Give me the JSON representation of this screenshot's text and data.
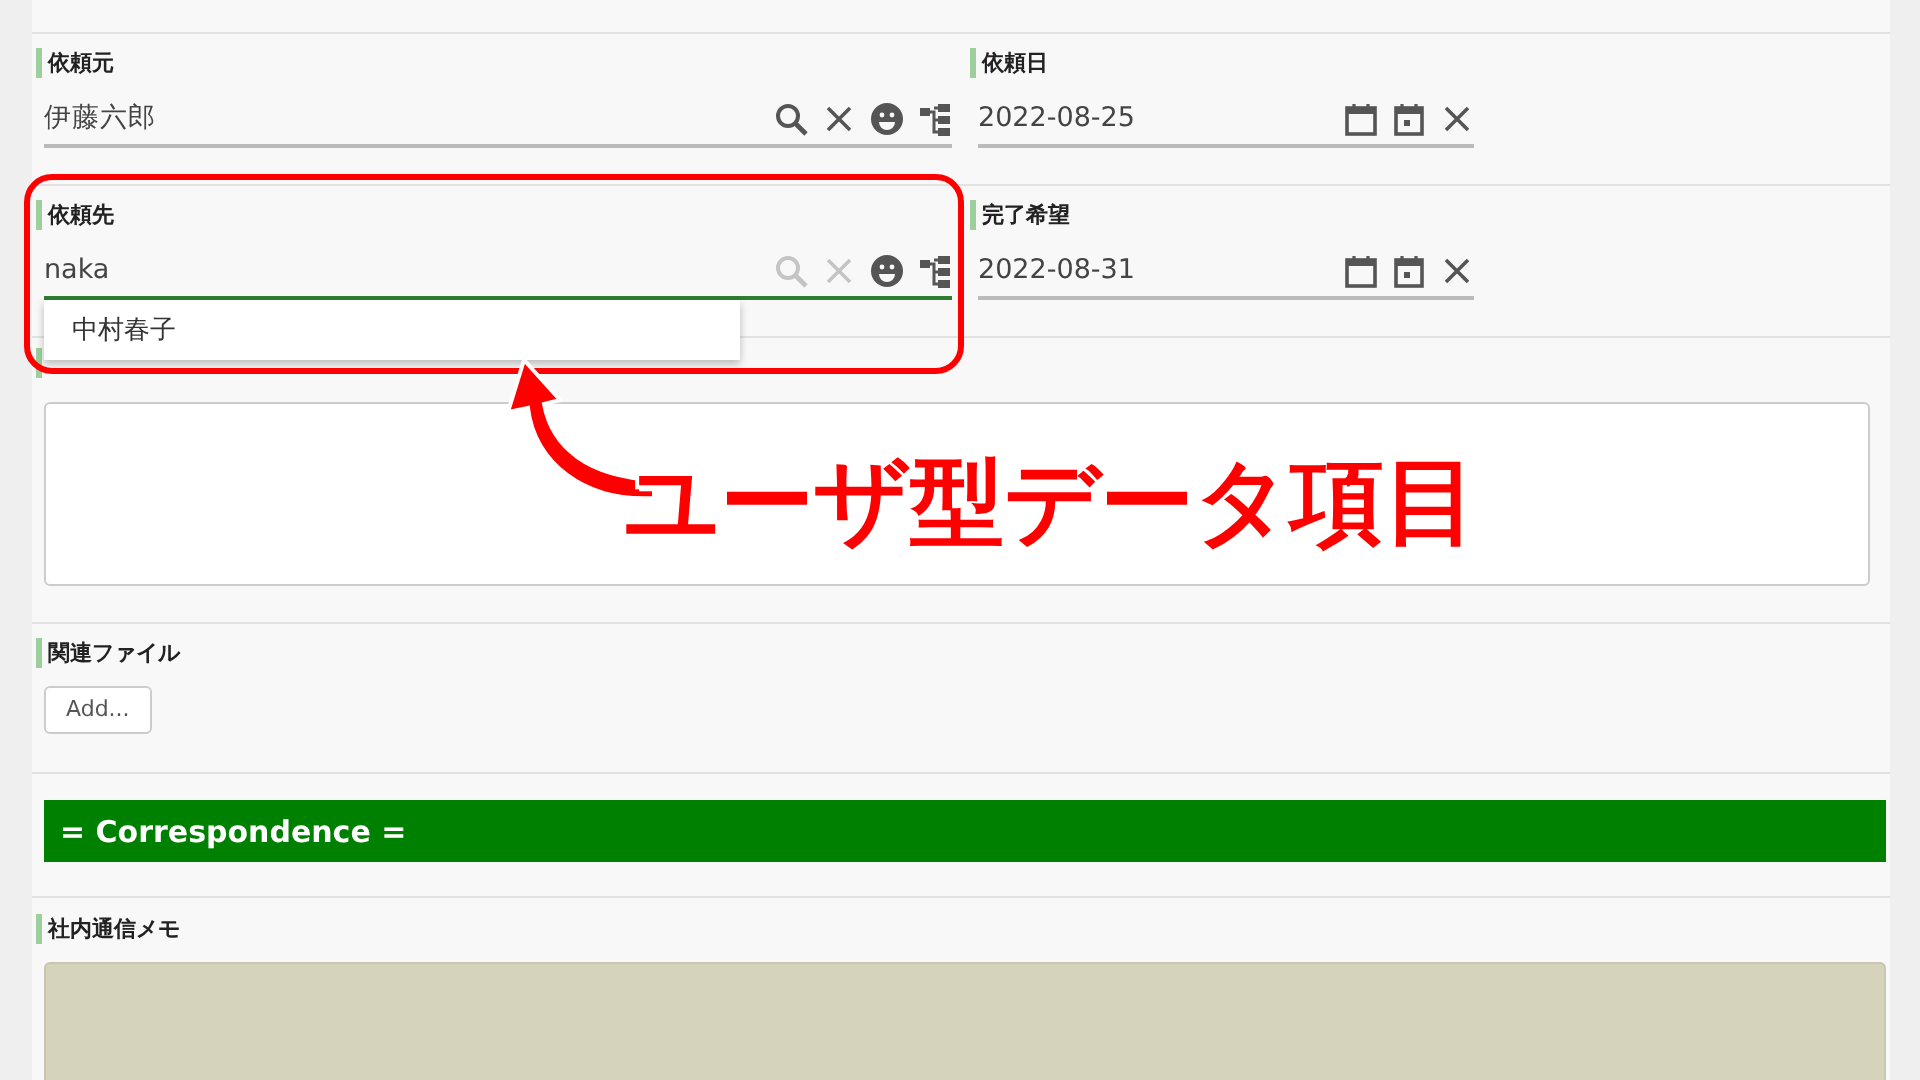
{
  "rows": [
    {
      "kind": "pair",
      "fields": [
        {
          "kind": "user",
          "label": "依頼元",
          "value": "伊藤六郎",
          "focused": false,
          "icons": [
            {
              "kind": "search",
              "disabled": false
            },
            {
              "kind": "clear",
              "disabled": false
            },
            {
              "kind": "face",
              "disabled": false
            },
            {
              "kind": "tree",
              "disabled": false
            }
          ]
        },
        {
          "kind": "date",
          "label": "依頼日",
          "value": "2022-08-25",
          "focused": false,
          "icons": [
            {
              "kind": "calendar",
              "disabled": false
            },
            {
              "kind": "today",
              "disabled": false
            },
            {
              "kind": "clear",
              "disabled": false
            }
          ]
        }
      ]
    },
    {
      "kind": "pair",
      "fields": [
        {
          "kind": "user",
          "label": "依頼先",
          "value": "naka",
          "focused": true,
          "suggestions": [
            "中村春子"
          ],
          "icons": [
            {
              "kind": "search",
              "disabled": true
            },
            {
              "kind": "clear",
              "disabled": true
            },
            {
              "kind": "face",
              "disabled": false
            },
            {
              "kind": "tree",
              "disabled": false
            }
          ]
        },
        {
          "kind": "date",
          "label": "完了希望",
          "value": "2022-08-31",
          "focused": false,
          "icons": [
            {
              "kind": "calendar",
              "disabled": false
            },
            {
              "kind": "today",
              "disabled": false
            },
            {
              "kind": "clear",
              "disabled": false
            }
          ]
        }
      ]
    },
    {
      "kind": "textarea"
    },
    {
      "kind": "file",
      "label": "関連ファイル",
      "button": "Add..."
    },
    {
      "kind": "heading",
      "text": "= Correspondence ="
    },
    {
      "kind": "memo",
      "label": "社内通信メモ"
    }
  ],
  "annotation": {
    "text": "ユーザ型データ項目"
  }
}
